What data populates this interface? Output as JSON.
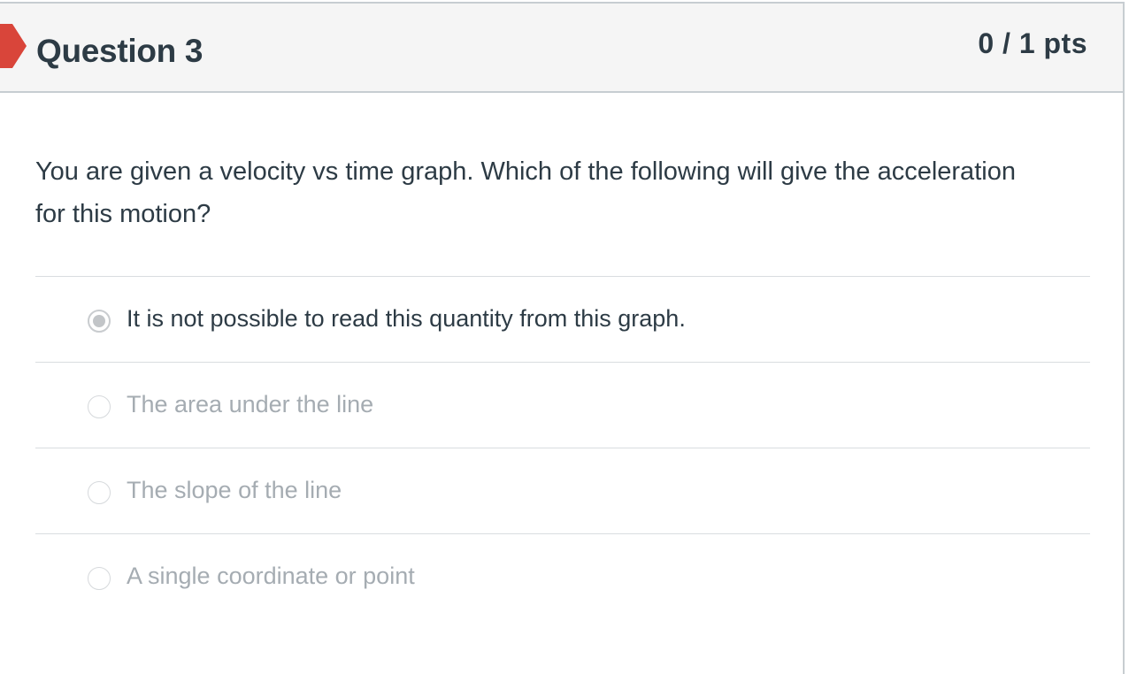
{
  "question": {
    "title": "Question 3",
    "points": "0 / 1 pts",
    "text": "You are given a velocity vs time graph.  Which of the following will give the acceleration for this motion?",
    "flag_icon": "incorrect-flag-icon",
    "flag_color": "#d9453a"
  },
  "answers": [
    {
      "label": "It is not possible to read this quantity from this graph.",
      "selected": true
    },
    {
      "label": "The area under the line",
      "selected": false
    },
    {
      "label": "The slope of the line",
      "selected": false
    },
    {
      "label": "A single coordinate or point",
      "selected": false
    }
  ],
  "colors": {
    "text_primary": "#2d3b45",
    "text_muted": "#a5acb2",
    "header_bg": "#f5f5f5",
    "border": "#c7cdd1"
  }
}
